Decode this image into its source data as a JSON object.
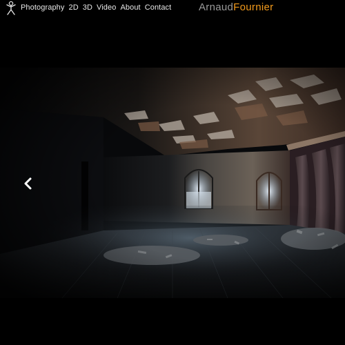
{
  "nav": {
    "items": [
      {
        "label": "Photography"
      },
      {
        "label": "2D"
      },
      {
        "label": "3D"
      },
      {
        "label": "Video"
      },
      {
        "label": "About"
      },
      {
        "label": "Contact"
      }
    ]
  },
  "brand": {
    "first": "Arnaud",
    "last": "Fournier",
    "accent_color": "#f29a1b"
  },
  "icons": {
    "logo": "figure-logo-icon",
    "slider_prev": "chevron-left-icon"
  }
}
